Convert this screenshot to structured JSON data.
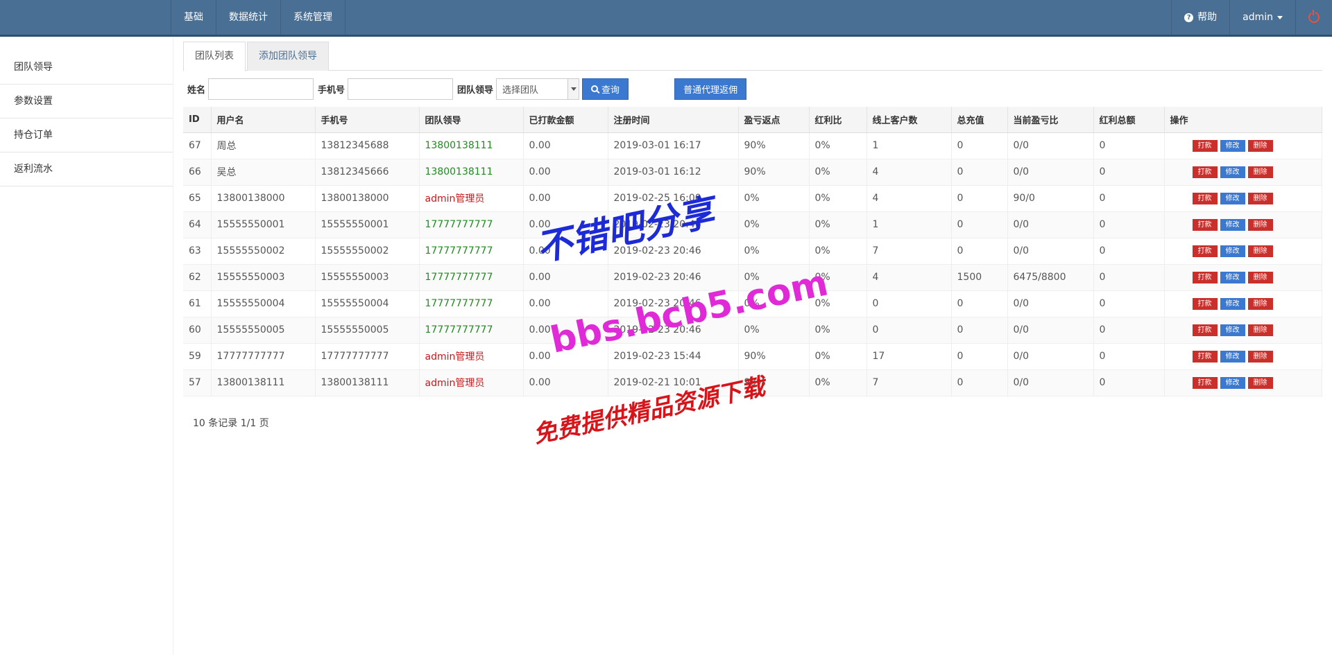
{
  "nav": {
    "items": [
      "基础",
      "数据统计",
      "系统管理"
    ],
    "help": "帮助",
    "user": "admin"
  },
  "sidebar": {
    "items": [
      "团队领导",
      "参数设置",
      "持仓订单",
      "返利流水"
    ]
  },
  "tabs": [
    "团队列表",
    "添加团队领导"
  ],
  "filter": {
    "name_label": "姓名",
    "phone_label": "手机号",
    "team_label": "团队领导",
    "team_select": "选择团队",
    "search_btn": "查询",
    "agent_btn": "普通代理返佣"
  },
  "table": {
    "headers": [
      "ID",
      "用户名",
      "手机号",
      "团队领导",
      "已打款金额",
      "注册时间",
      "盈亏返点",
      "红利比",
      "线上客户数",
      "总充值",
      "当前盈亏比",
      "红利总额",
      "操作"
    ],
    "actions": {
      "pay": "打款",
      "edit": "修改",
      "del": "删除"
    },
    "rows": [
      {
        "id": "67",
        "user": "周总",
        "phone": "13812345688",
        "leader": "13800138111",
        "leader_color": "green",
        "paid": "0.00",
        "reg": "2019-03-01 16:17",
        "rebate": "90%",
        "bonus": "0%",
        "clients": "1",
        "recharge": "0",
        "ratio": "0/0",
        "bonus_total": "0"
      },
      {
        "id": "66",
        "user": "吴总",
        "phone": "13812345666",
        "leader": "13800138111",
        "leader_color": "green",
        "paid": "0.00",
        "reg": "2019-03-01 16:12",
        "rebate": "90%",
        "bonus": "0%",
        "clients": "4",
        "recharge": "0",
        "ratio": "0/0",
        "bonus_total": "0"
      },
      {
        "id": "65",
        "user": "13800138000",
        "phone": "13800138000",
        "leader": "admin管理员",
        "leader_color": "red",
        "paid": "0.00",
        "reg": "2019-02-25 16:00",
        "rebate": "0%",
        "bonus": "0%",
        "clients": "4",
        "recharge": "0",
        "ratio": "90/0",
        "bonus_total": "0"
      },
      {
        "id": "64",
        "user": "15555550001",
        "phone": "15555550001",
        "leader": "17777777777",
        "leader_color": "green",
        "paid": "0.00",
        "reg": "2019-02-23 20:46",
        "rebate": "0%",
        "bonus": "0%",
        "clients": "1",
        "recharge": "0",
        "ratio": "0/0",
        "bonus_total": "0"
      },
      {
        "id": "63",
        "user": "15555550002",
        "phone": "15555550002",
        "leader": "17777777777",
        "leader_color": "green",
        "paid": "0.00",
        "reg": "2019-02-23 20:46",
        "rebate": "0%",
        "bonus": "0%",
        "clients": "7",
        "recharge": "0",
        "ratio": "0/0",
        "bonus_total": "0"
      },
      {
        "id": "62",
        "user": "15555550003",
        "phone": "15555550003",
        "leader": "17777777777",
        "leader_color": "green",
        "paid": "0.00",
        "reg": "2019-02-23 20:46",
        "rebate": "0%",
        "bonus": "0%",
        "clients": "4",
        "recharge": "1500",
        "ratio": "6475/8800",
        "bonus_total": "0"
      },
      {
        "id": "61",
        "user": "15555550004",
        "phone": "15555550004",
        "leader": "17777777777",
        "leader_color": "green",
        "paid": "0.00",
        "reg": "2019-02-23 20:46",
        "rebate": "0%",
        "bonus": "0%",
        "clients": "0",
        "recharge": "0",
        "ratio": "0/0",
        "bonus_total": "0"
      },
      {
        "id": "60",
        "user": "15555550005",
        "phone": "15555550005",
        "leader": "17777777777",
        "leader_color": "green",
        "paid": "0.00",
        "reg": "2019-02-23 20:46",
        "rebate": "0%",
        "bonus": "0%",
        "clients": "0",
        "recharge": "0",
        "ratio": "0/0",
        "bonus_total": "0"
      },
      {
        "id": "59",
        "user": "17777777777",
        "phone": "17777777777",
        "leader": "admin管理员",
        "leader_color": "red",
        "paid": "0.00",
        "reg": "2019-02-23 15:44",
        "rebate": "90%",
        "bonus": "0%",
        "clients": "17",
        "recharge": "0",
        "ratio": "0/0",
        "bonus_total": "0"
      },
      {
        "id": "57",
        "user": "13800138111",
        "phone": "13800138111",
        "leader": "admin管理员",
        "leader_color": "red",
        "paid": "0.00",
        "reg": "2019-02-21 10:01",
        "rebate": "93%",
        "bonus": "0%",
        "clients": "7",
        "recharge": "0",
        "ratio": "0/0",
        "bonus_total": "0"
      }
    ]
  },
  "pager": "10 条记录 1/1 页",
  "watermark": {
    "line1": "不错吧分享",
    "line2": "bbs.bcb5.com",
    "line3": "免费提供精品资源下载"
  }
}
